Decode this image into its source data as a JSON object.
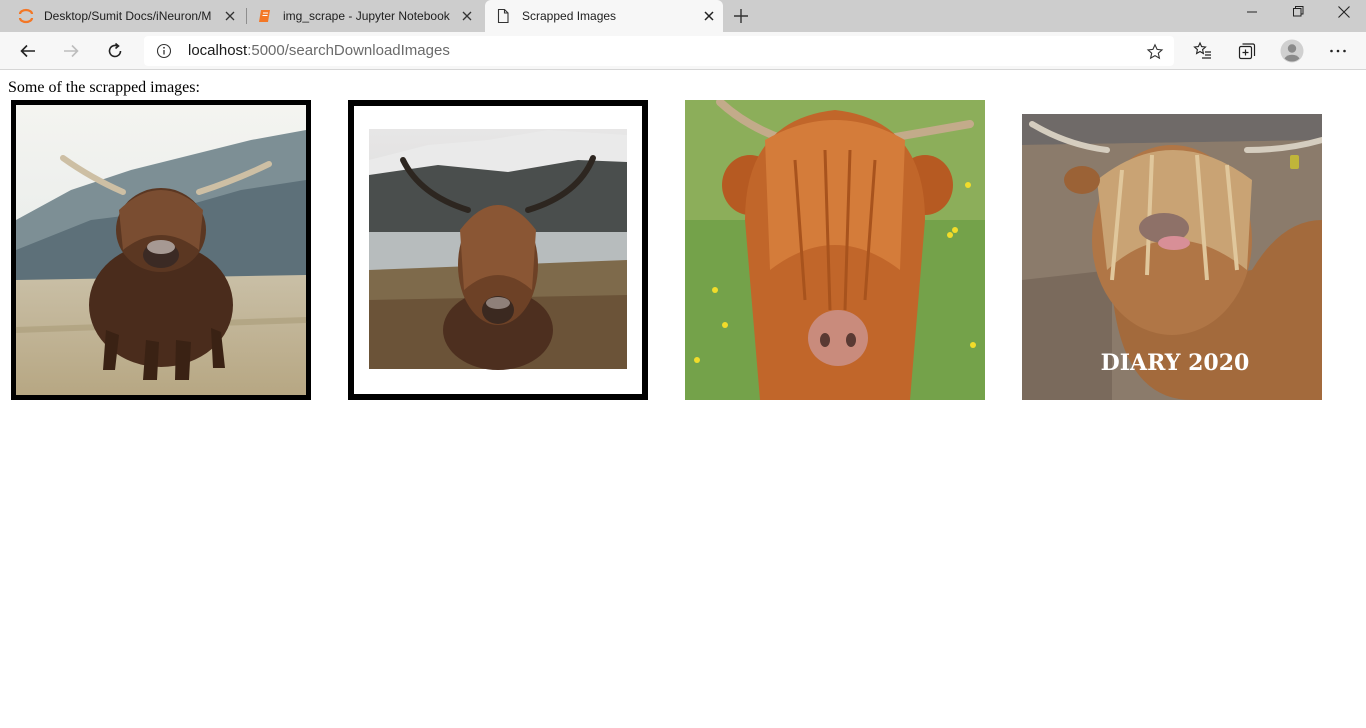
{
  "browser": {
    "tabs": [
      {
        "title": "Desktop/Sumit Docs/iNeuron/M",
        "icon": "jupyter-spinner-icon",
        "active": false
      },
      {
        "title": "img_scrape - Jupyter Notebook",
        "icon": "notebook-icon",
        "active": false
      },
      {
        "title": "Scrapped Images",
        "icon": "page-icon",
        "active": true
      }
    ],
    "address": {
      "host": "localhost",
      "path": ":5000/searchDownloadImages"
    }
  },
  "page": {
    "heading": "Some of the scrapped images:",
    "images": [
      {
        "name": "highland-cow-1",
        "style": "black-frame"
      },
      {
        "name": "highland-cow-2",
        "style": "black-frame-white-mat"
      },
      {
        "name": "highland-cow-3",
        "style": "plain"
      },
      {
        "name": "highland-cow-4",
        "style": "plain",
        "caption": "DIARY 2020"
      }
    ]
  },
  "colors": {
    "tabstrip": "#cdcdcd",
    "toolbar": "#f7f7f7",
    "jupyter_orange": "#f37726"
  }
}
